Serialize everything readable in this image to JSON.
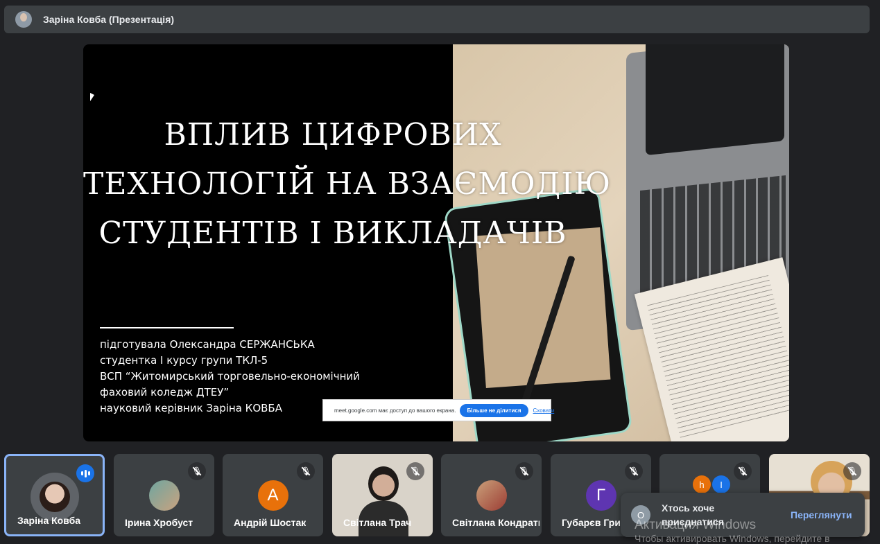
{
  "header": {
    "title": "Заріна Ковба (Презентація)"
  },
  "slide": {
    "title_lines": [
      "ВПЛИВ ЦИФРОВИХ",
      "ТЕХНОЛОГІЙ НА ВЗАЄМОДІЮ",
      "СТУДЕНТІВ І ВИКЛАДАЧІВ"
    ],
    "author_lines": [
      "підготувала Олександра СЕРЖАНСЬКА",
      "студентка І курсу групи ТКЛ-5",
      "ВСП “Житомирський торговельно-економічний",
      "фаховий коледж ДТЕУ”",
      "науковий керівник Заріна КОВБА"
    ]
  },
  "share_bar": {
    "message": "meet.google.com має доступ до вашого екрана.",
    "stop_label": "Більше не ділитися",
    "hide_label": "Сховати"
  },
  "participants": [
    {
      "name": "Заріна Ковба"
    },
    {
      "name": "Ірина Хробуст"
    },
    {
      "name": "Андрій Шостак",
      "initial": "А",
      "color": "#e8710a"
    },
    {
      "name": "Світлана Трач"
    },
    {
      "name": "Світлана Кондратюк"
    },
    {
      "name": "Губарєв Григорій",
      "initial": "Г",
      "color": "#5e35b1"
    },
    {
      "name": "",
      "initials": [
        "h",
        "I"
      ],
      "colors": [
        "#e8710a",
        "#1a73e8"
      ]
    },
    {
      "name": ""
    }
  ],
  "toast": {
    "avatar": "O",
    "message": "Хтось хоче приєднатися",
    "action": "Переглянути"
  },
  "watermark": {
    "line1": "Активация Windows",
    "line2": "Чтобы активировать Windows, перейдите в"
  }
}
